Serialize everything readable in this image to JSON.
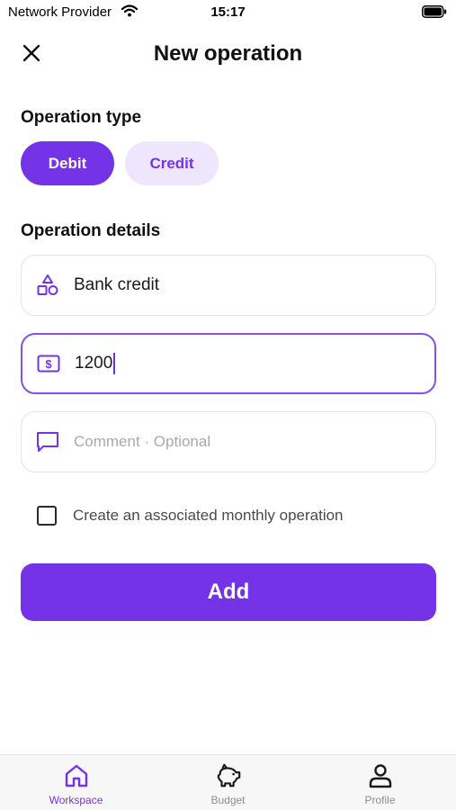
{
  "status_bar": {
    "carrier": "Network Provider",
    "time": "15:17"
  },
  "header": {
    "title": "New operation"
  },
  "operation_type": {
    "title": "Operation type",
    "options": [
      {
        "label": "Debit",
        "selected": true
      },
      {
        "label": "Credit",
        "selected": false
      }
    ]
  },
  "operation_details": {
    "title": "Operation details",
    "name_value": "Bank credit",
    "amount_value": "1200",
    "comment_placeholder": "Comment · Optional",
    "monthly_label": "Create an associated monthly operation",
    "monthly_checked": false
  },
  "add_button": {
    "label": "Add"
  },
  "tab_bar": {
    "tabs": [
      {
        "label": "Workspace",
        "icon": "home-icon",
        "active": true
      },
      {
        "label": "Budget",
        "icon": "piggy-bank-icon",
        "active": false
      },
      {
        "label": "Profile",
        "icon": "person-icon",
        "active": false
      }
    ]
  },
  "colors": {
    "accent": "#7533e8",
    "accent_light": "#eee6fd",
    "inactive_tab": "#8e8e93"
  }
}
